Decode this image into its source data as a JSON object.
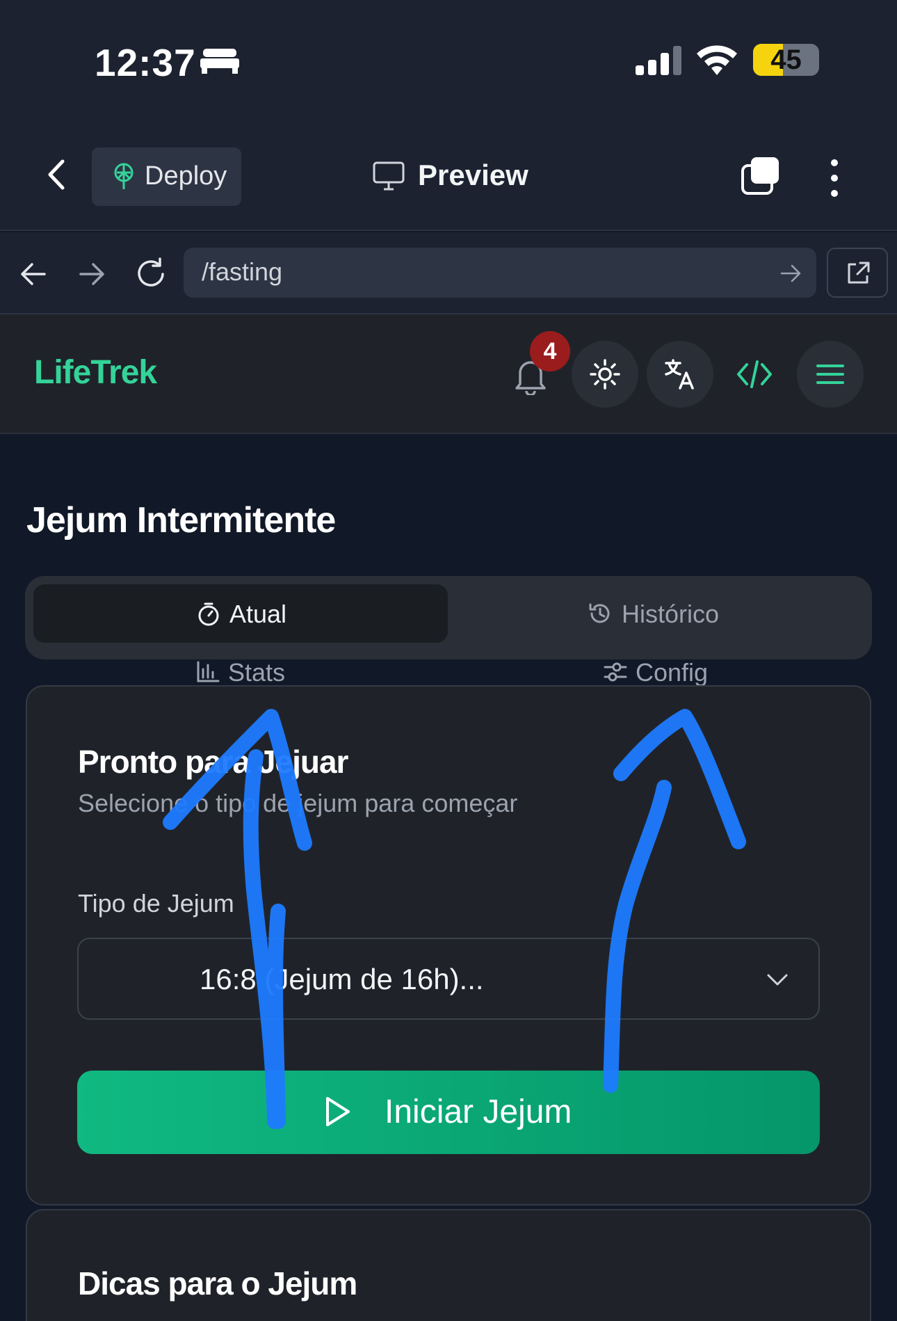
{
  "status_bar": {
    "time": "12:37",
    "battery": "45",
    "battery_level": 0.45,
    "icons": [
      "bed-icon",
      "signal-icon",
      "wifi-icon",
      "battery-icon"
    ]
  },
  "editor_toolbar": {
    "deploy_label": "Deploy",
    "preview_label": "Preview",
    "icons": [
      "back-chevron-icon",
      "deploy-icon",
      "monitor-icon",
      "tabs-icon",
      "more-vertical-icon"
    ]
  },
  "browser": {
    "url": "/fasting",
    "icons": [
      "arrow-left-icon",
      "arrow-right-icon",
      "reload-icon",
      "go-arrow-icon",
      "open-external-icon"
    ]
  },
  "app_header": {
    "logo": "LifeTrek",
    "notification_count": "4",
    "icons": [
      "bell-icon",
      "sun-icon",
      "translate-icon",
      "code-icon",
      "menu-icon"
    ]
  },
  "main": {
    "title": "Jejum Intermitente",
    "tabs": [
      {
        "label": "Atual",
        "icon": "timer-icon",
        "active": true
      },
      {
        "label": "Histórico",
        "icon": "history-icon",
        "active": false
      },
      {
        "label": "Stats",
        "icon": "bar-chart-icon",
        "active": false
      },
      {
        "label": "Config",
        "icon": "sliders-icon",
        "active": false
      }
    ],
    "card": {
      "title": "Pronto para Jejuar",
      "subtitle": "Selecione o tipo de jejum para começar",
      "field_label": "Tipo de Jejum",
      "select_value": "16:8 (Jejum de 16h)...",
      "start_button": "Iniciar Jejum"
    },
    "tips_card": {
      "title": "Dicas para o Jejum"
    }
  },
  "colors": {
    "accent": "#10b981",
    "logo": "#34d399",
    "badge": "#9b1c1c",
    "annotation": "#1e7bff"
  }
}
